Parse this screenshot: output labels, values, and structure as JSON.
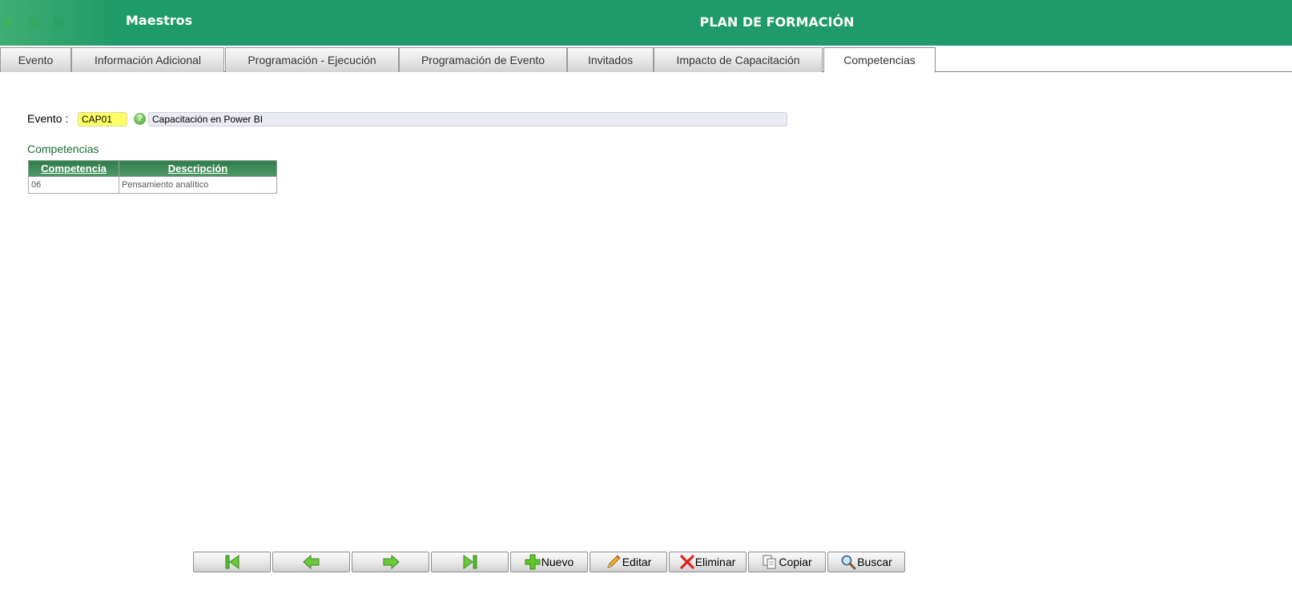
{
  "header": {
    "app_title": "Maestros",
    "page_title": "PLAN DE FORMACIÓN"
  },
  "tabs": [
    {
      "label": "Evento"
    },
    {
      "label": "Información Adicional"
    },
    {
      "label": "Programación - Ejecución"
    },
    {
      "label": "Programación de Evento"
    },
    {
      "label": "Invitados"
    },
    {
      "label": "Impacto de Capacitación"
    },
    {
      "label": "Competencias",
      "active": true
    }
  ],
  "evento": {
    "label": "Evento :",
    "code": "CAP01",
    "help_icon": "question-icon",
    "description": "Capacitación en Power BI"
  },
  "competencias": {
    "title": "Competencias",
    "columns": [
      "Competencia",
      "Descripción"
    ],
    "rows": [
      {
        "competencia": "06",
        "descripcion": "Pensamiento analítico"
      }
    ]
  },
  "toolbar": {
    "first_icon": "first-record-icon",
    "prev_icon": "previous-record-icon",
    "next_icon": "next-record-icon",
    "last_icon": "last-record-icon",
    "nuevo": "Nuevo",
    "editar": "Editar",
    "eliminar": "Eliminar",
    "copiar": "Copiar",
    "buscar": "Buscar"
  },
  "colors": {
    "header_green": "#1f9a6a",
    "code_yellow": "#ffff66",
    "section_green": "#1e6b3a",
    "grid_header": "#3d8a57"
  }
}
